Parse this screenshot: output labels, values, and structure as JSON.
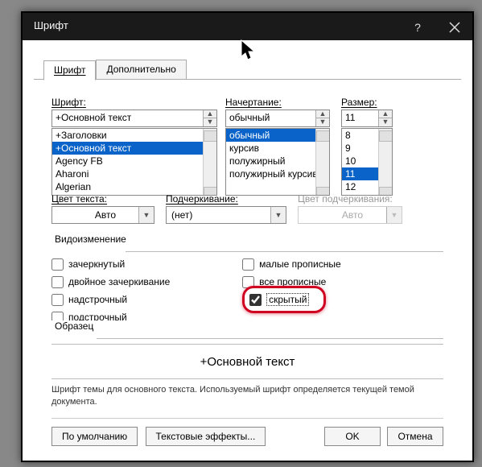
{
  "window": {
    "title": "Шрифт"
  },
  "tabs": {
    "font": "Шрифт",
    "advanced": "Дополнительно"
  },
  "labels": {
    "font": "Шрифт:",
    "style": "Начертание:",
    "size": "Размер:",
    "color": "Цвет текста:",
    "underline": "Подчеркивание:",
    "ucolor": "Цвет подчеркивания:",
    "effects": "Видоизменение",
    "sample": "Образец"
  },
  "font": {
    "value": "+Основной текст",
    "list": [
      "+Заголовки",
      "+Основной текст",
      "Agency FB",
      "Aharoni",
      "Algerian"
    ],
    "selected_index": 1
  },
  "style": {
    "value": "обычный",
    "list": [
      "обычный",
      "курсив",
      "полужирный",
      "полужирный курсив"
    ],
    "selected_index": 0
  },
  "size": {
    "value": "11",
    "list": [
      "8",
      "9",
      "10",
      "11",
      "12"
    ],
    "selected_index": 3
  },
  "color": {
    "value": "Авто"
  },
  "underline": {
    "value": "(нет)"
  },
  "ucolor": {
    "value": "Авто"
  },
  "effects_list": {
    "left": [
      {
        "label": "зачеркнутый",
        "checked": false
      },
      {
        "label": "двойное зачеркивание",
        "checked": false
      },
      {
        "label": "надстрочный",
        "checked": false
      },
      {
        "label": "подстрочный",
        "checked": false
      }
    ],
    "right": [
      {
        "label": "малые прописные",
        "checked": false
      },
      {
        "label": "все прописные",
        "checked": false
      },
      {
        "label": "скрытый",
        "checked": true
      }
    ]
  },
  "sample_text": "+Основной текст",
  "hint": "Шрифт темы для основного текста. Используемый шрифт определяется текущей темой документа.",
  "buttons": {
    "default": "По умолчанию",
    "textfx": "Текстовые эффекты...",
    "ok": "OK",
    "cancel": "Отмена"
  }
}
